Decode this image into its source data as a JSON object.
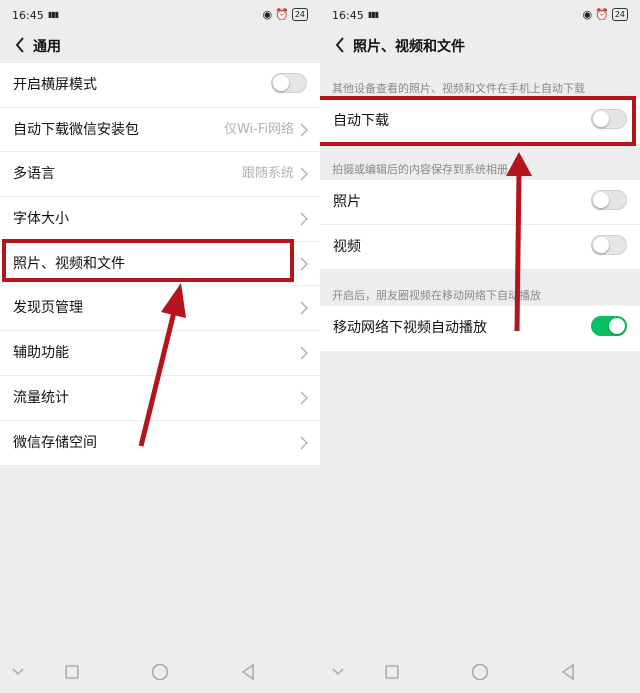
{
  "status_bar": {
    "time": "16:45",
    "signal": "4G",
    "battery": "24"
  },
  "left": {
    "title": "通用",
    "items": [
      {
        "label": "开启横屏模式",
        "value": "",
        "control": "toggle",
        "on": false
      },
      {
        "label": "自动下载微信安装包",
        "value": "仅Wi-Fi网络",
        "control": "chevron"
      },
      {
        "label": "多语言",
        "value": "跟随系统",
        "control": "chevron"
      },
      {
        "label": "字体大小",
        "value": "",
        "control": "chevron"
      },
      {
        "label": "照片、视频和文件",
        "value": "",
        "control": "chevron"
      },
      {
        "label": "发现页管理",
        "value": "",
        "control": "chevron"
      },
      {
        "label": "辅助功能",
        "value": "",
        "control": "chevron"
      },
      {
        "label": "流量统计",
        "value": "",
        "control": "chevron"
      },
      {
        "label": "微信存储空间",
        "value": "",
        "control": "chevron"
      }
    ]
  },
  "right": {
    "title": "照片、视频和文件",
    "sections": [
      {
        "hint": "其他设备查看的照片、视频和文件在手机上自动下载",
        "items": [
          {
            "label": "自动下载",
            "on": false
          }
        ]
      },
      {
        "hint": "拍摄或编辑后的内容保存到系统相册",
        "items": [
          {
            "label": "照片",
            "on": false
          },
          {
            "label": "视频",
            "on": false
          }
        ]
      },
      {
        "hint": "开启后，朋友圈视频在移动网络下自动播放",
        "items": [
          {
            "label": "移动网络下视频自动播放",
            "on": true
          }
        ]
      }
    ]
  },
  "colors": {
    "accent_green": "#07c160",
    "annotation_red": "#b5141c"
  },
  "nav_icons": [
    "chevron-down-icon",
    "square-icon",
    "circle-icon",
    "triangle-back-icon"
  ]
}
